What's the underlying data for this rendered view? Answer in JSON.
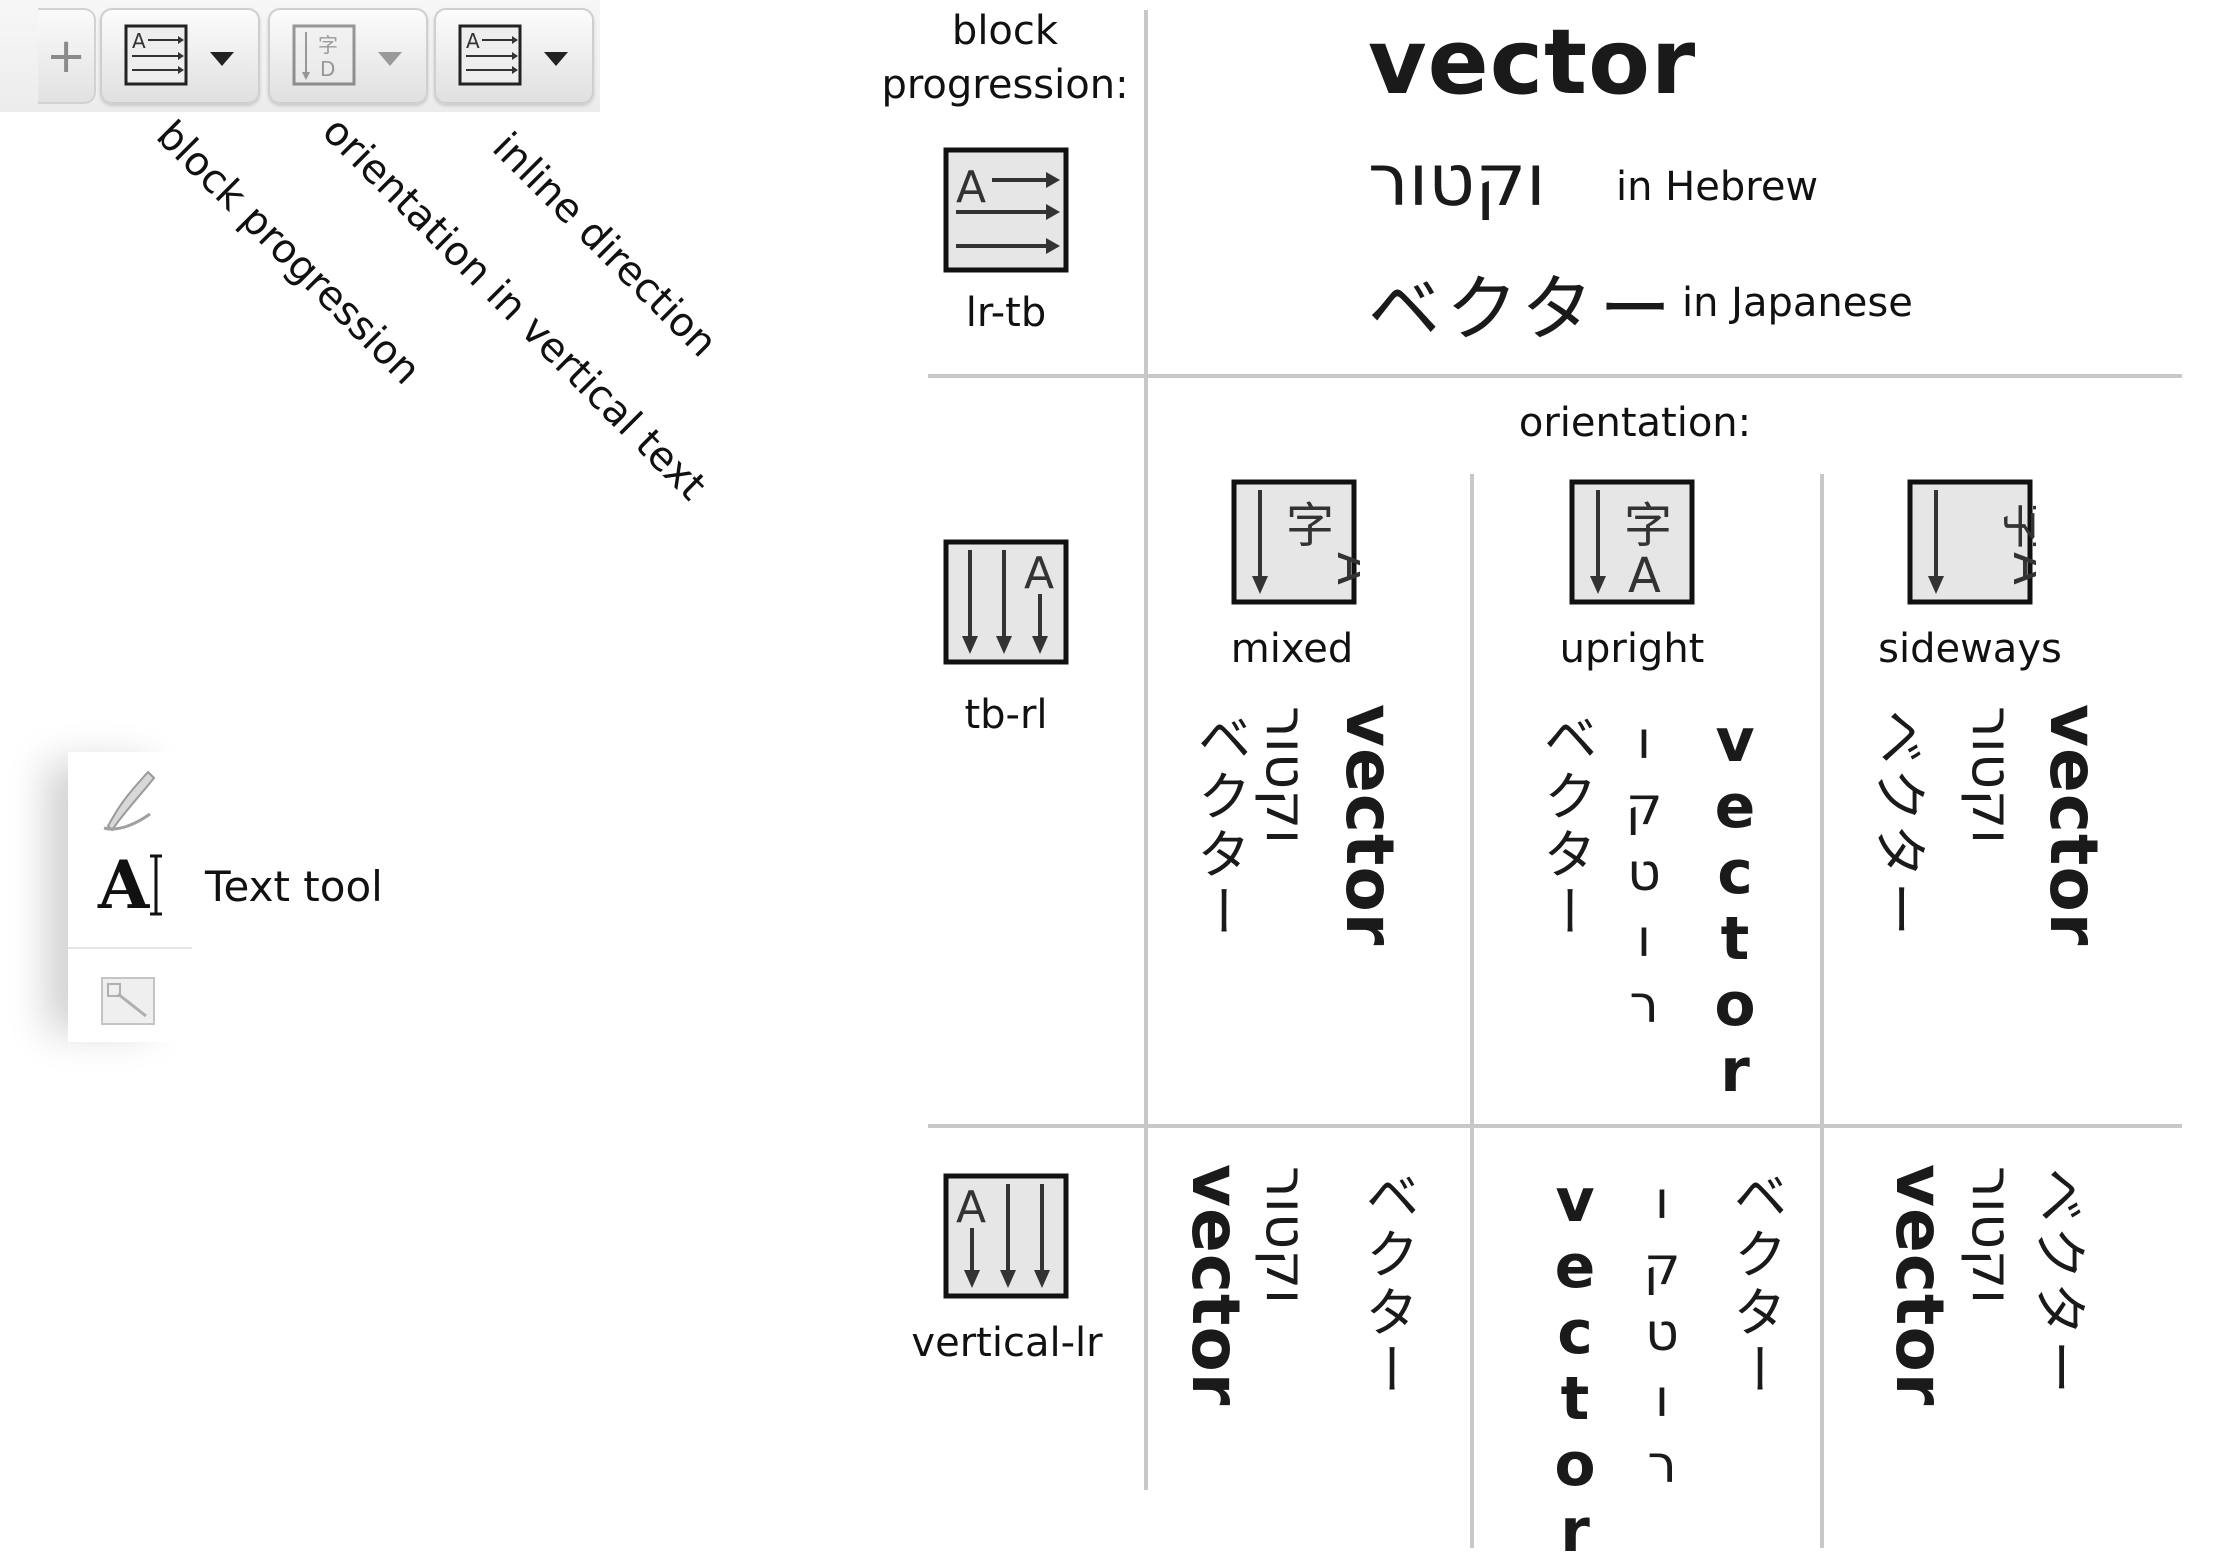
{
  "toolbar": {
    "plus_glyph": "+",
    "buttons": [
      {
        "name": "block-progression-button",
        "icon": "lr-tb-icon"
      },
      {
        "name": "orientation-button",
        "icon": "vertical-orientation-icon"
      },
      {
        "name": "inline-direction-button",
        "icon": "inline-direction-icon"
      }
    ],
    "labels": {
      "block_progression": "block progression",
      "orientation": "orientation in vertical text",
      "inline_direction": "inline direction"
    }
  },
  "tool_panel": {
    "text_tool_label": "Text tool"
  },
  "grid": {
    "block_header": "block\nprogression:",
    "orientation_header": "orientation:",
    "rows": {
      "lr_tb": "lr-tb",
      "tb_rl": "tb-rl",
      "vertical_lr": "vertical-lr"
    },
    "orientations": {
      "mixed": "mixed",
      "upright": "upright",
      "sideways": "sideways"
    }
  },
  "words": {
    "english": "vector",
    "hebrew": "וקטור",
    "japanese": "ベクター",
    "in_hebrew": "in Hebrew",
    "in_japanese": "in Japanese"
  },
  "colors": {
    "grid_line": "#c8c8c8",
    "icon_bg": "#e6e6e6",
    "text": "#111111"
  }
}
